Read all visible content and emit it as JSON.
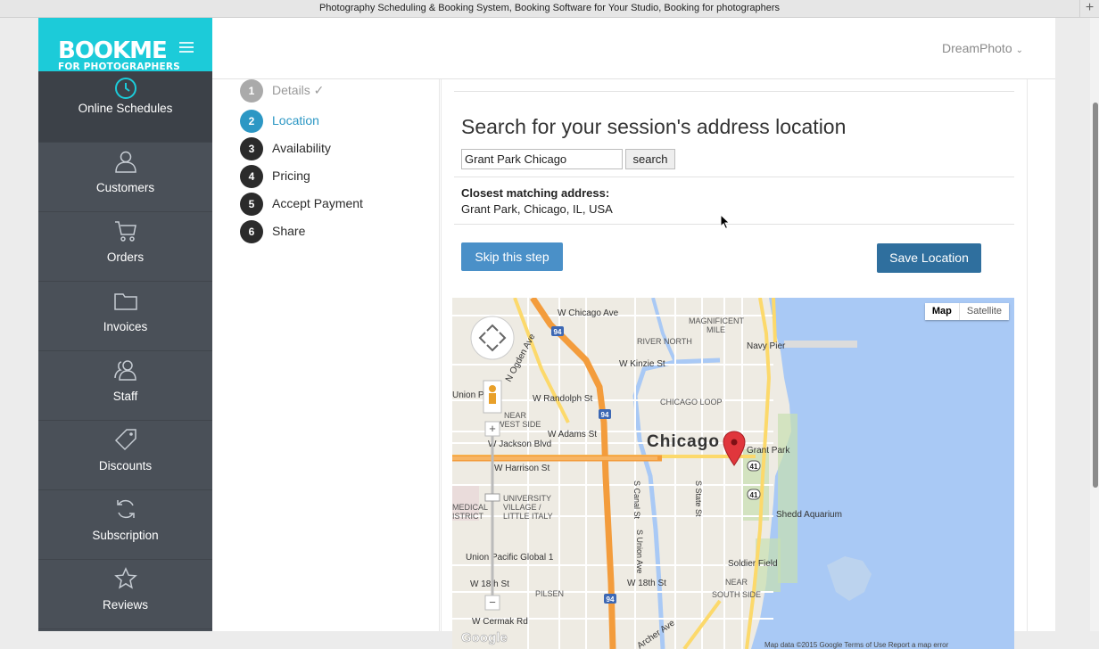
{
  "window": {
    "title": "Photography Scheduling & Booking System, Booking Software for Your Studio, Booking for photographers"
  },
  "brand": {
    "logo_main": "BOOKME",
    "logo_sub": "FOR PHOTOGRAPHERS",
    "accent_color": "#1ccbd9"
  },
  "header": {
    "user_menu": "DreamPhoto"
  },
  "sidebar": {
    "items": [
      {
        "label": "Online Schedules",
        "icon": "clock-icon",
        "active": true
      },
      {
        "label": "Customers",
        "icon": "user-icon"
      },
      {
        "label": "Orders",
        "icon": "cart-icon"
      },
      {
        "label": "Invoices",
        "icon": "folder-icon"
      },
      {
        "label": "Staff",
        "icon": "staff-icon"
      },
      {
        "label": "Discounts",
        "icon": "tag-icon"
      },
      {
        "label": "Subscription",
        "icon": "refresh-icon"
      },
      {
        "label": "Reviews",
        "icon": "star-icon"
      }
    ]
  },
  "steps": [
    {
      "num": "1",
      "label": "Details ✓",
      "state": "done"
    },
    {
      "num": "2",
      "label": "Location",
      "state": "current"
    },
    {
      "num": "3",
      "label": "Availability",
      "state": "todo"
    },
    {
      "num": "4",
      "label": "Pricing",
      "state": "todo"
    },
    {
      "num": "5",
      "label": "Accept Payment",
      "state": "todo"
    },
    {
      "num": "6",
      "label": "Share",
      "state": "todo"
    }
  ],
  "location": {
    "title": "Search for your session's address location",
    "search_value": "Grant Park Chicago",
    "search_button": "search",
    "closest_label": "Closest matching address:",
    "closest_value": "Grant Park, Chicago, IL, USA",
    "skip_button": "Skip this step",
    "save_button": "Save Location"
  },
  "map": {
    "type_map": "Map",
    "type_satellite": "Satellite",
    "city_label": "Chicago",
    "labels": {
      "chicago_ave": "W Chicago Ave",
      "magnificent_mile_1": "MAGNIFICENT",
      "magnificent_mile_2": "MILE",
      "navy_pier": "Navy Pier",
      "river_north": "RIVER NORTH",
      "kinzie": "W Kinzie St",
      "ogden": "N Ogden Ave",
      "union_park": "Union Park",
      "randolph": "W Randolph St",
      "chicago_loop": "CHICAGO LOOP",
      "near_west_1": "NEAR",
      "near_west_2": "WEST SIDE",
      "adams": "W Adams St",
      "jackson": "W Jackson Blvd",
      "harrison": "W Harrison St",
      "grant_park": "Grant Park",
      "canal": "S Canal St",
      "state": "S State St",
      "university_village_1": "UNIVERSITY",
      "university_village_2": "VILLAGE /",
      "university_village_3": "LITTLE ITALY",
      "medical_1": "MEDICAL",
      "medical_2": "ISTRICT",
      "shedd": "Shedd Aquarium",
      "union_pacific": "Union Pacific Global 1",
      "soldier_field": "Soldier Field",
      "w18th_1": "W 18th St",
      "w18th_2": "W 18th St",
      "pilsen": "PILSEN",
      "near_south_1": "NEAR",
      "near_south_2": "SOUTH SIDE",
      "cermak": "W Cermak Rd",
      "archer": "Archer Ave",
      "s_union": "S Union Ave",
      "i94_a": "94",
      "i94_b": "94",
      "i94_c": "94",
      "us41_a": "41",
      "us41_b": "41",
      "footer": "Map data ©2015 Google   Terms of Use   Report a map error",
      "google": "Google"
    },
    "colors": {
      "land": "#eeebe3",
      "water": "#a9c9f5",
      "highway": "#f39c3c",
      "arterial": "#fcd96b",
      "marker": "#e0363c"
    }
  }
}
